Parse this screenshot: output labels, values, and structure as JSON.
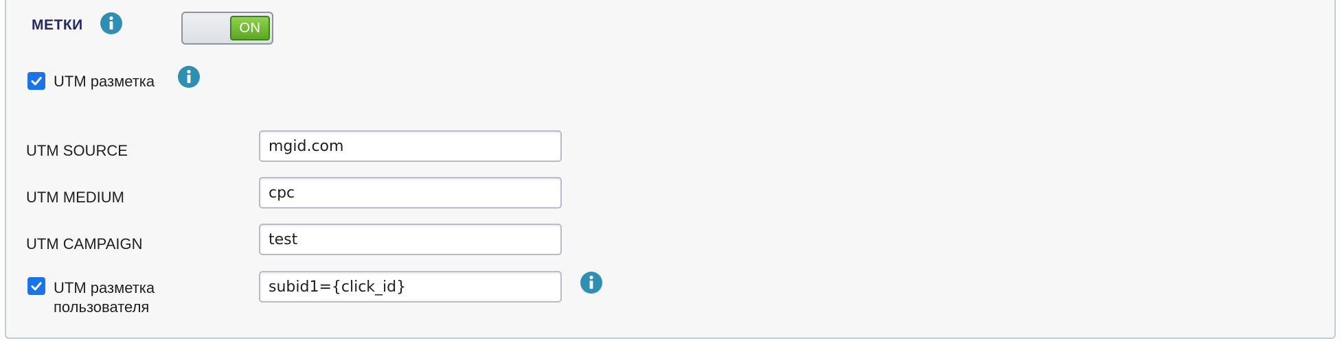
{
  "section": {
    "title": "МЕТКИ",
    "toggle_label": "ON"
  },
  "utm_markup": {
    "label": "UTM разметка",
    "checked": true
  },
  "fields": [
    {
      "label": "UTM SOURCE",
      "value": "mgid.com"
    },
    {
      "label": "UTM MEDIUM",
      "value": "cpc"
    },
    {
      "label": "UTM CAMPAIGN",
      "value": "test"
    }
  ],
  "custom_markup": {
    "label_line1": "UTM разметка",
    "label_line2": "пользователя",
    "checked": true,
    "value": "subid1={click_id}"
  },
  "icons": {
    "info": "info-icon",
    "checkmark": "checkmark-icon"
  },
  "colors": {
    "accent_blue": "#2f8fb3",
    "checkbox_blue": "#1b73e8",
    "toggle_green": "#5da625",
    "title_navy": "#25295f"
  }
}
